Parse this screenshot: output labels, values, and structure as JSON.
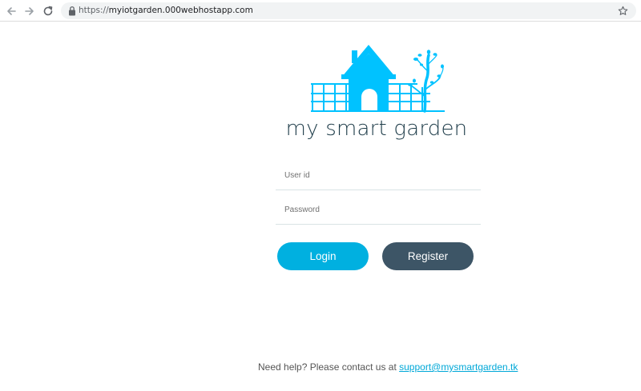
{
  "browser": {
    "url_scheme": "https://",
    "url_host": "myiotgarden.000webhostapp.com"
  },
  "brand": {
    "name": "my smart garden",
    "logo_color": "#00c2ff",
    "text_color": "#1f3d4a"
  },
  "login_form": {
    "user_placeholder": "User id",
    "password_placeholder": "Password",
    "login_label": "Login",
    "register_label": "Register",
    "login_color": "#00b0e0",
    "register_color": "#3d5566"
  },
  "footer": {
    "help_text": "Need help? Please contact us at ",
    "support_email": "support@mysmartgarden.tk"
  },
  "icons": [
    "back-icon",
    "forward-icon",
    "reload-icon",
    "lock-icon",
    "star-icon"
  ]
}
